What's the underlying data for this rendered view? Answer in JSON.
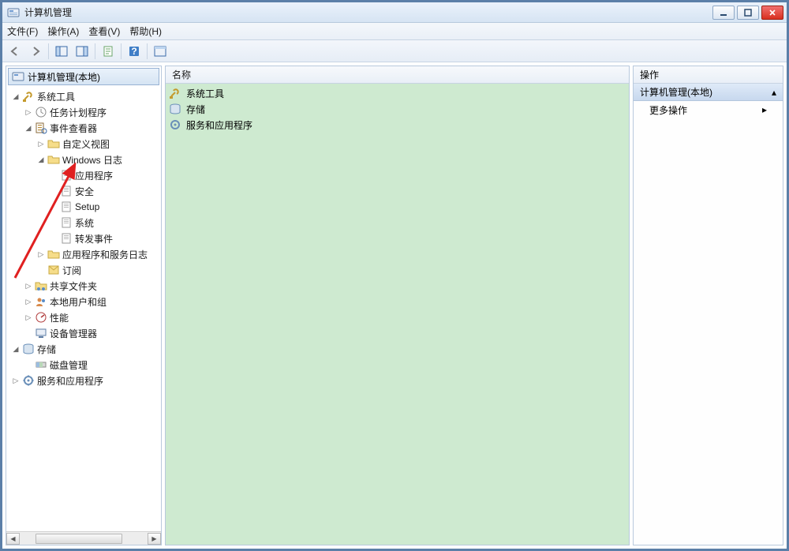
{
  "window": {
    "title": "计算机管理"
  },
  "menus": {
    "file": "文件(F)",
    "action": "操作(A)",
    "view": "查看(V)",
    "help": "帮助(H)"
  },
  "tree": {
    "root": "计算机管理(本地)",
    "sys_tools": "系统工具",
    "task_sched": "任务计划程序",
    "event_viewer": "事件查看器",
    "custom_views": "自定义视图",
    "windows_logs": "Windows 日志",
    "log_app": "应用程序",
    "log_sec": "安全",
    "log_setup": "Setup",
    "log_sys": "系统",
    "log_fwd": "转发事件",
    "app_svc_logs": "应用程序和服务日志",
    "subscriptions": "订阅",
    "shared_folders": "共享文件夹",
    "local_users": "本地用户和组",
    "performance": "性能",
    "dev_mgr": "设备管理器",
    "storage": "存储",
    "disk_mgmt": "磁盘管理",
    "svc_apps": "服务和应用程序"
  },
  "mid": {
    "header": "名称",
    "items": {
      "sys_tools": "系统工具",
      "storage": "存储",
      "svc_apps": "服务和应用程序"
    }
  },
  "right": {
    "header": "操作",
    "section": "计算机管理(本地)",
    "more": "更多操作"
  }
}
